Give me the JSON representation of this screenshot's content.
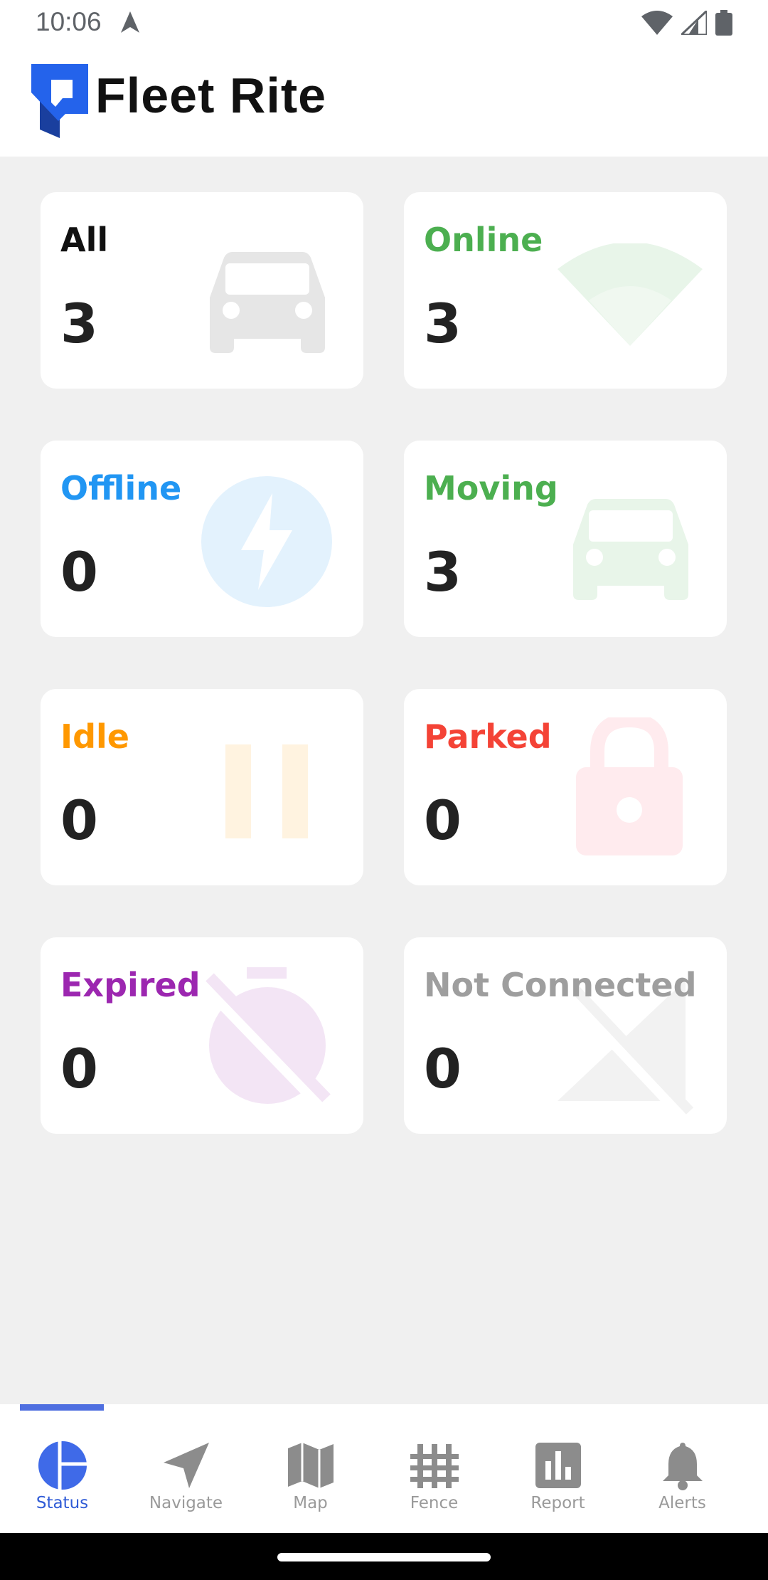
{
  "status_bar": {
    "time": "10:06"
  },
  "app": {
    "title": "Fleet Rite"
  },
  "cards": [
    {
      "label": "All",
      "value": "3",
      "color": "#111111",
      "icon": "car-icon"
    },
    {
      "label": "Online",
      "value": "3",
      "color": "#4caf50",
      "icon": "wifi-icon"
    },
    {
      "label": "Offline",
      "value": "0",
      "color": "#2196f3",
      "icon": "bolt-icon"
    },
    {
      "label": "Moving",
      "value": "3",
      "color": "#4caf50",
      "icon": "car-icon"
    },
    {
      "label": "Idle",
      "value": "0",
      "color": "#ff9800",
      "icon": "pause-icon"
    },
    {
      "label": "Parked",
      "value": "0",
      "color": "#f44336",
      "icon": "lock-icon"
    },
    {
      "label": "Expired",
      "value": "0",
      "color": "#9c27b0",
      "icon": "timer-off-icon"
    },
    {
      "label": "Not Connected",
      "value": "0",
      "color": "#9e9e9e",
      "icon": "signal-off-icon"
    }
  ],
  "nav": {
    "items": [
      {
        "label": "Status",
        "icon": "pie-chart-icon",
        "active": true
      },
      {
        "label": "Navigate",
        "icon": "navigation-arrow-icon",
        "active": false
      },
      {
        "label": "Map",
        "icon": "map-icon",
        "active": false
      },
      {
        "label": "Fence",
        "icon": "fence-grid-icon",
        "active": false
      },
      {
        "label": "Report",
        "icon": "bar-chart-icon",
        "active": false
      },
      {
        "label": "Alerts",
        "icon": "bell-icon",
        "active": false
      }
    ]
  },
  "colors": {
    "accent": "#2f5bd6",
    "background": "#f0f0f0"
  }
}
